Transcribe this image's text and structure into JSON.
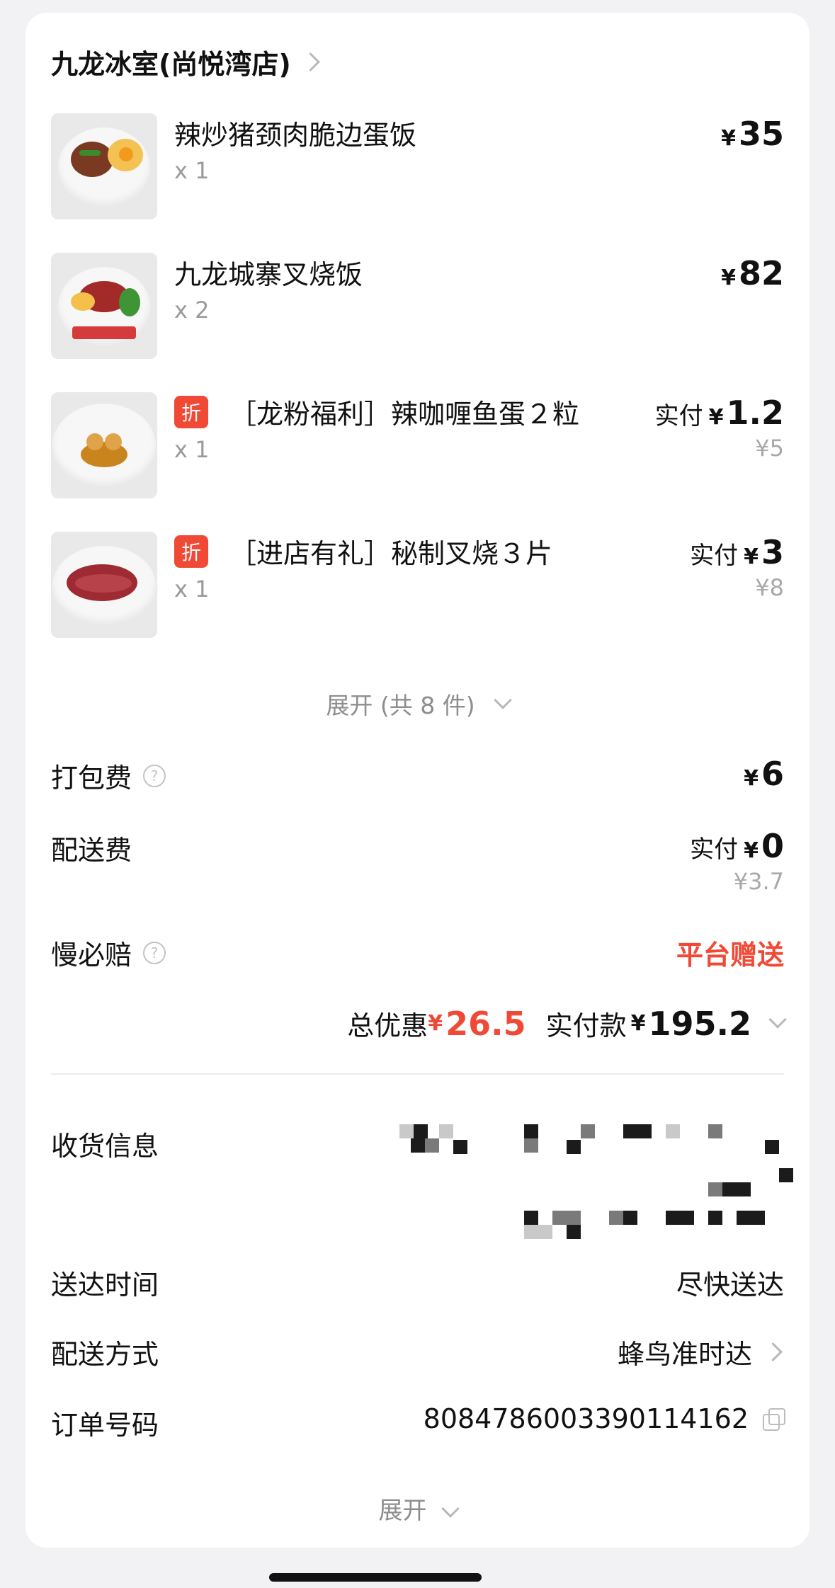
{
  "store": {
    "name": "九龙冰室(尚悦湾店)"
  },
  "items": [
    {
      "name": "辣炒猪颈肉脆边蛋饭",
      "qty": "x 1",
      "yen": "¥",
      "price": "35",
      "badge": "",
      "paid_label": "",
      "orig": ""
    },
    {
      "name": "九龙城寨叉烧饭",
      "qty": "x 2",
      "yen": "¥",
      "price": "82",
      "badge": "",
      "paid_label": "",
      "orig": ""
    },
    {
      "name": "［龙粉福利］辣咖喱鱼蛋２粒",
      "qty": "x 1",
      "yen": "¥",
      "price": "1.2",
      "badge": "折",
      "paid_label": "实付",
      "orig": "¥5"
    },
    {
      "name": "［进店有礼］秘制叉烧３片",
      "qty": "x 1",
      "yen": "¥",
      "price": "3",
      "badge": "折",
      "paid_label": "实付",
      "orig": "¥8"
    }
  ],
  "expand_items": "展开 (共 8 件)",
  "fees": {
    "packing": {
      "label": "打包费",
      "yen": "¥",
      "value": "6"
    },
    "delivery": {
      "label": "配送费",
      "paid_label": "实付",
      "yen": "¥",
      "value": "0",
      "orig": "¥3.7"
    },
    "late_comp": {
      "label": "慢必赔",
      "value": "平台赠送"
    }
  },
  "totals": {
    "discount_label": "总优惠",
    "discount_yen": "¥",
    "discount_value": "26.5",
    "paid_label": "实付款",
    "paid_yen": "¥",
    "paid_value": "195.2"
  },
  "info": {
    "receiver_label": "收货信息",
    "time_label": "送达时间",
    "time_value": "尽快送达",
    "method_label": "配送方式",
    "method_value": "蜂鸟准时达",
    "order_label": "订单号码",
    "order_value": "8084786003390114162"
  },
  "expand_more": "展开",
  "colors": {
    "accent": "#f04a37",
    "muted": "#9a9a9a"
  },
  "icons": [
    "chevron-right-icon",
    "chevron-down-icon",
    "help-circle-icon",
    "copy-icon"
  ]
}
